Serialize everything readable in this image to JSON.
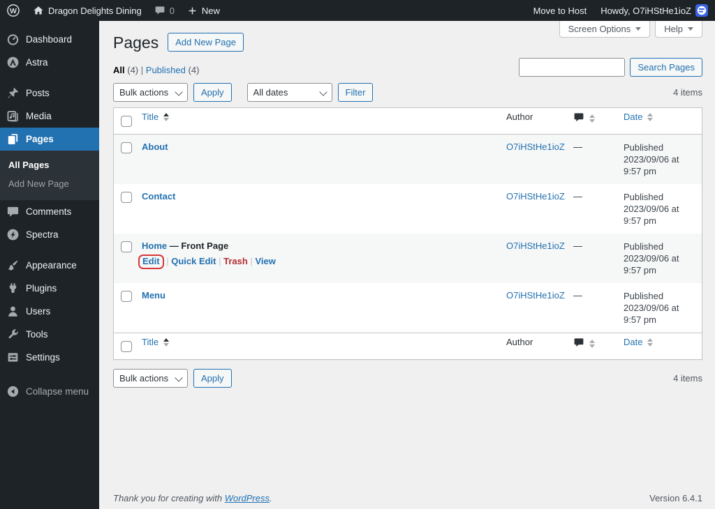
{
  "admin_bar": {
    "site_name": "Dragon Delights Dining",
    "comment_count": "0",
    "new_label": "New",
    "move_to_host": "Move to Host",
    "howdy": "Howdy, O7iHStHe1ioZ"
  },
  "sidebar": {
    "dashboard": "Dashboard",
    "astra": "Astra",
    "posts": "Posts",
    "media": "Media",
    "pages": "Pages",
    "all_pages": "All Pages",
    "add_new_page": "Add New Page",
    "comments": "Comments",
    "spectra": "Spectra",
    "appearance": "Appearance",
    "plugins": "Plugins",
    "users": "Users",
    "tools": "Tools",
    "settings": "Settings",
    "collapse": "Collapse menu"
  },
  "screen_meta": {
    "screen_options": "Screen Options",
    "help": "Help"
  },
  "page": {
    "title": "Pages",
    "add_new_button": "Add New Page",
    "search_button": "Search Pages",
    "search_value": "",
    "items_count": "4 items"
  },
  "views": {
    "all_label": "All",
    "all_count": "(4)",
    "separator": "|",
    "published_label": "Published",
    "published_count": "(4)"
  },
  "filters": {
    "bulk_actions": "Bulk actions",
    "apply": "Apply",
    "all_dates": "All dates",
    "filter": "Filter"
  },
  "table": {
    "columns": {
      "title": "Title",
      "author": "Author",
      "date": "Date"
    },
    "rows": [
      {
        "title": "About",
        "suffix": "",
        "author": "O7iHStHe1ioZ",
        "comments": "—",
        "status": "Published",
        "date": "2023/09/06 at 9:57 pm"
      },
      {
        "title": "Contact",
        "suffix": "",
        "author": "O7iHStHe1ioZ",
        "comments": "—",
        "status": "Published",
        "date": "2023/09/06 at 9:57 pm"
      },
      {
        "title": "Home",
        "suffix": "— Front Page",
        "author": "O7iHStHe1ioZ",
        "comments": "—",
        "status": "Published",
        "date": "2023/09/06 at 9:57 pm"
      },
      {
        "title": "Menu",
        "suffix": "",
        "author": "O7iHStHe1ioZ",
        "comments": "—",
        "status": "Published",
        "date": "2023/09/06 at 9:57 pm"
      }
    ],
    "row_actions": {
      "edit": "Edit",
      "quick_edit": "Quick Edit",
      "trash": "Trash",
      "view": "View",
      "separator": "|"
    }
  },
  "footer": {
    "thanks_prefix": "Thank you for creating with ",
    "wordpress_link": "WordPress",
    "thanks_suffix": ".",
    "version": "Version 6.4.1"
  },
  "colors": {
    "accent": "#2271b1",
    "link": "#2271b1",
    "trash_link": "#b32d2e",
    "annotation_red": "#d63638",
    "admin_bar_bg": "#1d2327",
    "stripe_row": "#f6f7f7",
    "content_bg": "#f0f0f1"
  },
  "icons": {
    "wordpress-logo-icon": "circled W",
    "home-icon": "house",
    "comments-bubble-icon": "speech bubble",
    "plus-icon": "plus",
    "avatar": "blue host logo",
    "dashboard-icon": "gauge",
    "astra-icon": "A in circle",
    "posts-icon": "pushpin",
    "media-icon": "frame with music note",
    "pages-icon": "stacked pages",
    "spectra-icon": "S bolt in circle",
    "appearance-icon": "paintbrush",
    "plugins-icon": "plug",
    "users-icon": "person",
    "tools-icon": "wrench",
    "settings-icon": "slider panel",
    "collapse-icon": "circle with left arrow",
    "sort-icon": "up/down triangles",
    "dropdown-caret-icon": "down triangle"
  }
}
